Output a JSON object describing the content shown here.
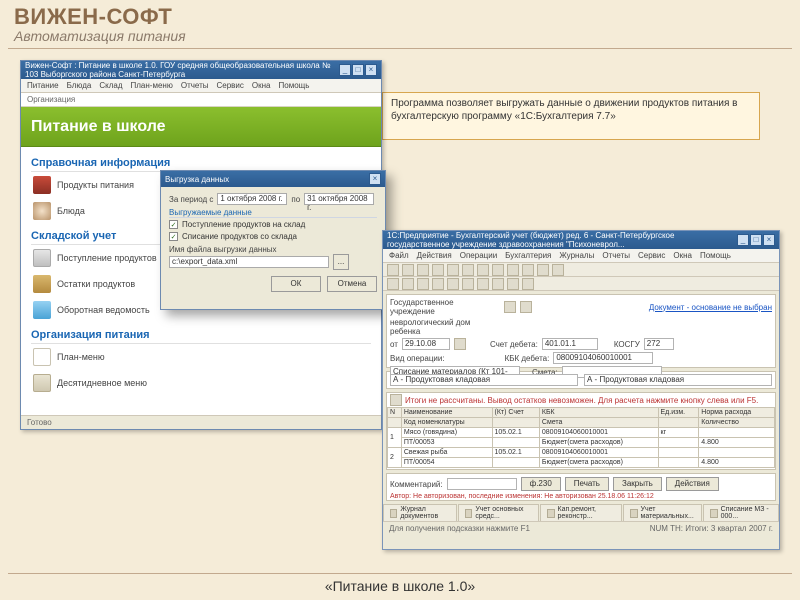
{
  "page": {
    "title": "ВИЖЕН-СОФТ",
    "subtitle": "Автоматизация питания",
    "footer": "«Питание в школе 1.0»"
  },
  "callout": "Программа позволяет выгружать данные о движении продуктов питания в бухгалтерскую программу «1С:Бухгалтерия 7.7»",
  "left_window": {
    "title": "Вижен-Софт : Питание в школе 1.0. ГОУ средняя общеобразовательная школа № 103 Выборгского района Санкт-Петербурга",
    "menu": [
      "Питание",
      "Блюда",
      "Склад",
      "План-меню",
      "Отчеты",
      "Сервис",
      "Окна",
      "Помощь"
    ],
    "breadcrumb": "Организация",
    "banner": "Питание в школе",
    "sections": {
      "ref": "Справочная информация",
      "ref_items": [
        "Продукты питания",
        "Блюда"
      ],
      "stock": "Складской учет",
      "stock_items": [
        "Поступление продуктов",
        "Остатки продуктов",
        "Оборотная ведомость"
      ],
      "org": "Организация питания",
      "org_items": [
        "План-меню",
        "Десятидневное меню"
      ]
    },
    "status": "Готово"
  },
  "dialog": {
    "title": "Выгрузка данных",
    "period_lbl": "За период с",
    "date_from": "1 октября 2008 г.",
    "to_lbl": "по",
    "date_to": "31 октября 2008 г.",
    "group_hd": "Выгружаемые данные",
    "cb1": "Поступление продуктов на склад",
    "cb2": "Списание продуктов со склада",
    "file_lbl": "Имя файла выгрузки данных",
    "file_val": "c:\\export_data.xml",
    "ok": "ОК",
    "cancel": "Отмена"
  },
  "win1c": {
    "title": "1С:Предприятие - Бухгалтерский учет (бюджет) ред. 6 - Санкт-Петербургское государственное учреждение здравоохранения \"Психоневрол...",
    "menu": [
      "Файл",
      "Действия",
      "Операции",
      "Бухгалтерия",
      "Журналы",
      "Отчеты",
      "Сервис",
      "Окна",
      "Помощь"
    ],
    "doc_link": "Документ - основание не выбран",
    "org_lbl": "Государственное учреждение",
    "org_val": "неврологический дом ребенка",
    "date_lbl": "от",
    "date_val": "29.10.08",
    "op_lbl": "Вид операции:",
    "op_val": "Списание материалов (Кт 101-272)",
    "acc_lbl": "Счет дебета:",
    "acc_val": "401.01.1",
    "kosgu_lbl": "КОСГУ",
    "kosgu_val": "272",
    "kbk_lbl": "КБК дебета:",
    "kbk_val": "08009104060010001",
    "smeta_lbl": "Смета:",
    "mol_from_lbl": "А - Продуктовая кладовая",
    "mol_to_lbl": "А - Продуктовая кладовая",
    "hint": "Итоги не рассчитаны. Вывод остатков невозможен. Для расчета нажмите кнопку слева или F5.",
    "table": {
      "headers": [
        "N",
        "Наименование",
        "(Кт) Счет",
        "КБК",
        "Ед.изм.",
        "Норма расхода"
      ],
      "sub_headers": [
        "",
        "Код номенклатуры",
        "",
        "Смета",
        "",
        "Количество"
      ],
      "rows": [
        {
          "n": "1",
          "name": "Мясо (говядина)",
          "code": "ПТ/00053",
          "acct": "105.02.1",
          "kbk": "08009104060010001",
          "smeta": "Бюджет(смета расходов)",
          "unit": "кг",
          "qty": "4.800"
        },
        {
          "n": "2",
          "name": "Свежая рыба",
          "code": "ПТ/00054",
          "acct": "105.02.1",
          "kbk": "08009104060010001",
          "smeta": "Бюджет(смета расходов)",
          "unit": "",
          "qty": "4.800"
        }
      ]
    },
    "comment_lbl": "Комментарий:",
    "btns": {
      "f230": "ф.230",
      "print": "Печать",
      "close": "Закрыть",
      "actions": "Действия"
    },
    "auth_note": "Автор: Не авторизован, последние изменения: Не авторизован 25.18.06 11:26:12",
    "tabs": [
      "Журнал документов",
      "Учет основных средс...",
      "Кап.ремонт, реконстр...",
      "Учет материальных...",
      "Списание МЗ - 000..."
    ],
    "status_left": "Для получения подсказки нажмите F1",
    "status_right": "NUM  ТН: Итоги: 3 квартал 2007 г."
  }
}
